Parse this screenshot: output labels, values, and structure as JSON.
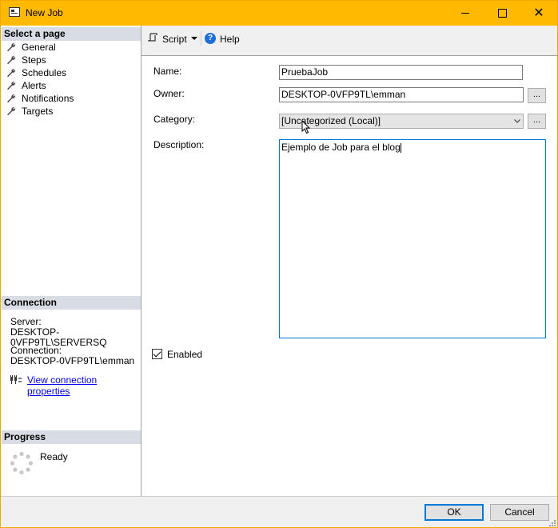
{
  "window": {
    "title": "New Job"
  },
  "left_panel": {
    "select_page_header": "Select a page",
    "pages": [
      {
        "label": "General"
      },
      {
        "label": "Steps"
      },
      {
        "label": "Schedules"
      },
      {
        "label": "Alerts"
      },
      {
        "label": "Notifications"
      },
      {
        "label": "Targets"
      }
    ],
    "connection_header": "Connection",
    "server_label": "Server:",
    "server_value": "DESKTOP-0VFP9TL\\SERVERSQ",
    "connection_label": "Connection:",
    "connection_value": "DESKTOP-0VFP9TL\\emman",
    "view_connection_link": "View connection properties",
    "progress_header": "Progress",
    "progress_status": "Ready"
  },
  "toolbar": {
    "script_label": "Script",
    "help_label": "Help"
  },
  "form": {
    "name_label": "Name:",
    "name_value": "PruebaJob",
    "owner_label": "Owner:",
    "owner_value": "DESKTOP-0VFP9TL\\emman",
    "category_label": "Category:",
    "category_value": "[Uncategorized (Local)]",
    "description_label": "Description:",
    "description_value": "Ejemplo de Job para el blog",
    "ellipsis_label": "...",
    "enabled_label": "Enabled",
    "enabled_checked": true
  },
  "buttons": {
    "ok": "OK",
    "cancel": "Cancel"
  },
  "colors": {
    "titlebar": "#ffb900",
    "section_header": "#d8dce4",
    "focus_border": "#0078d7",
    "link": "#0000ee"
  }
}
